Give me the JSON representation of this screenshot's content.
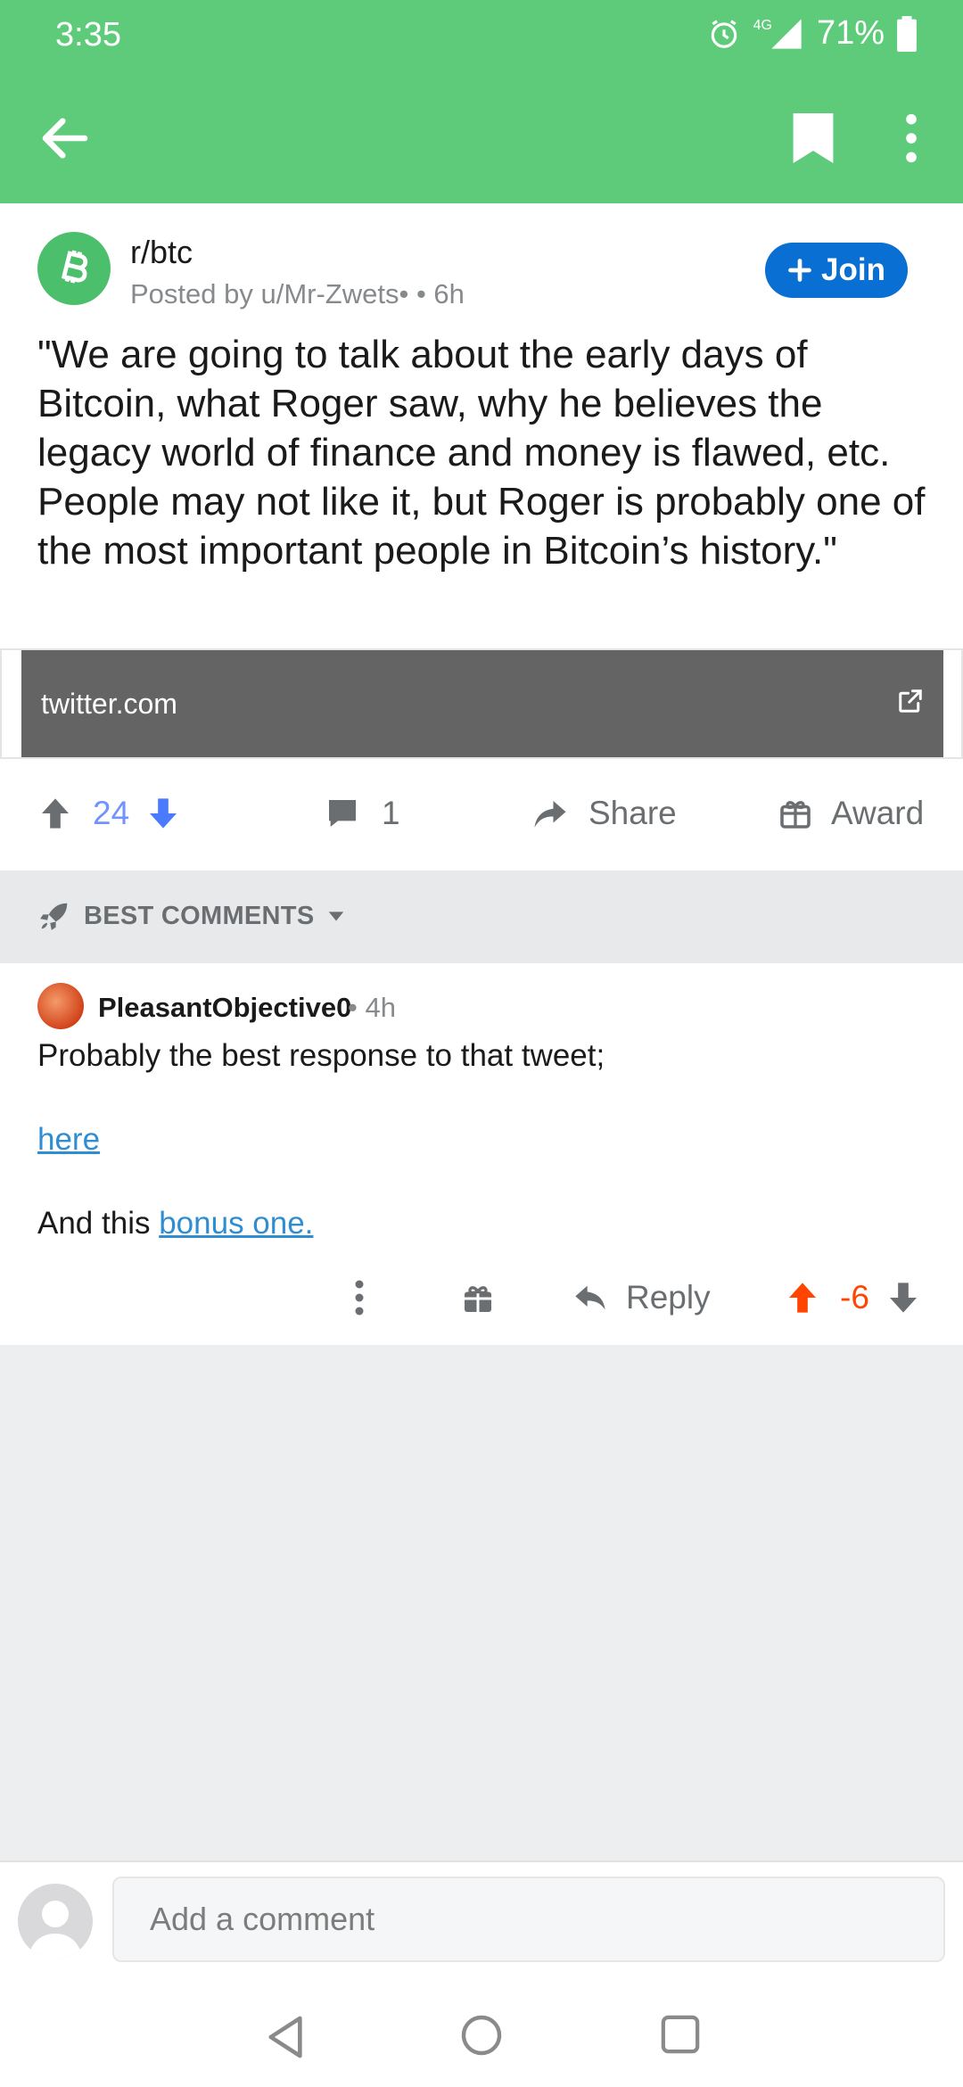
{
  "status_bar": {
    "time": "3:35",
    "network": "4G",
    "battery": "71%",
    "icons": [
      "alarm-icon",
      "signal-icon",
      "battery-icon"
    ]
  },
  "nav": {
    "icons": [
      "back-arrow-icon",
      "bookmark-icon",
      "more-vert-icon"
    ]
  },
  "post": {
    "subreddit": "r/btc",
    "posted_by": "Posted by u/Mr-Zwets•  • 6h",
    "join_label": "Join",
    "title": "\"We are going to talk about the early days of Bitcoin, what Roger saw, why he believes the legacy world of finance and money is flawed, etc. People may not like it, but Roger is probably one of the most important people in Bitcoin’s history.\"",
    "link_domain": "twitter.com",
    "score": "24",
    "comments": "1",
    "share_label": "Share",
    "award_label": "Award"
  },
  "sort": {
    "label": "BEST COMMENTS"
  },
  "comment": {
    "author": "PleasantObjective0",
    "time": "• 4h",
    "line1": "Probably the best response to that tweet;",
    "link1": "here",
    "line3_prefix": "And this ",
    "link2": "bonus one.",
    "reply_label": "Reply",
    "score": "-6"
  },
  "composer": {
    "placeholder": "Add a comment"
  },
  "colors": {
    "header_green": "#5ecb7a",
    "join_blue": "#0a6fd2",
    "upvote_orange": "#ff4500",
    "vote_blue": "#7193ff",
    "link_blue": "#2f8dd1"
  }
}
